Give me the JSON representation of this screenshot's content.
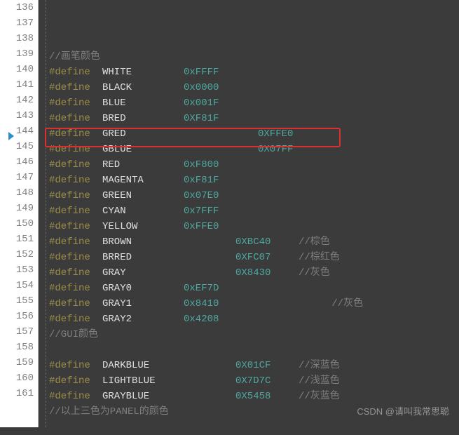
{
  "watermark": "CSDN @请叫我常思聪",
  "lines": [
    {
      "n": 136,
      "cells": []
    },
    {
      "n": 137,
      "cells": [
        {
          "t": "//画笔颜色",
          "cls": "c-comment"
        }
      ]
    },
    {
      "n": 138,
      "cells": [
        {
          "t": "#define ",
          "cls": "c-define seg w1"
        },
        {
          "t": "WHITE",
          "cls": "c-macro seg w2"
        },
        {
          "t": "0xFFFF",
          "cls": "c-hex"
        }
      ]
    },
    {
      "n": 139,
      "cells": [
        {
          "t": "#define ",
          "cls": "c-define seg w1"
        },
        {
          "t": "BLACK",
          "cls": "c-macro seg w2"
        },
        {
          "t": "0x0000",
          "cls": "c-hex"
        }
      ]
    },
    {
      "n": 140,
      "cells": [
        {
          "t": "#define ",
          "cls": "c-define seg w1"
        },
        {
          "t": "BLUE",
          "cls": "c-macro seg w2"
        },
        {
          "t": "0x001F",
          "cls": "c-hex"
        }
      ]
    },
    {
      "n": 141,
      "cells": [
        {
          "t": "#define ",
          "cls": "c-define seg w1"
        },
        {
          "t": "BRED",
          "cls": "c-macro seg w2"
        },
        {
          "t": "0XF81F",
          "cls": "c-hex"
        }
      ]
    },
    {
      "n": 142,
      "cells": [
        {
          "t": "#define ",
          "cls": "c-define seg w1"
        },
        {
          "t": "GRED",
          "cls": "c-macro seg w2"
        },
        {
          "t": "",
          "cls": "seg w4"
        },
        {
          "t": "0XFFE0",
          "cls": "c-hex"
        }
      ]
    },
    {
      "n": 143,
      "cells": [
        {
          "t": "#define ",
          "cls": "c-define seg w1"
        },
        {
          "t": "GBLUE",
          "cls": "c-macro seg w2"
        },
        {
          "t": "",
          "cls": "seg w4"
        },
        {
          "t": "0X07FF",
          "cls": "c-hex"
        }
      ]
    },
    {
      "n": 144,
      "cells": [
        {
          "t": "#define ",
          "cls": "c-define seg w1"
        },
        {
          "t": "RED",
          "cls": "c-macro seg w2"
        },
        {
          "t": "0xF800",
          "cls": "c-hex"
        }
      ]
    },
    {
      "n": 145,
      "cells": [
        {
          "t": "#define ",
          "cls": "c-define seg w1"
        },
        {
          "t": "MAGENTA",
          "cls": "c-macro seg w2"
        },
        {
          "t": "0xF81F",
          "cls": "c-hex"
        }
      ]
    },
    {
      "n": 146,
      "cells": [
        {
          "t": "#define ",
          "cls": "c-define seg w1"
        },
        {
          "t": "GREEN",
          "cls": "c-macro seg w2"
        },
        {
          "t": "0x07E0",
          "cls": "c-hex"
        }
      ]
    },
    {
      "n": 147,
      "cells": [
        {
          "t": "#define ",
          "cls": "c-define seg w1"
        },
        {
          "t": "CYAN",
          "cls": "c-macro seg w2"
        },
        {
          "t": "0x7FFF",
          "cls": "c-hex"
        }
      ]
    },
    {
      "n": 148,
      "cells": [
        {
          "t": "#define ",
          "cls": "c-define seg w1"
        },
        {
          "t": "YELLOW",
          "cls": "c-macro seg w2"
        },
        {
          "t": "0xFFE0",
          "cls": "c-hex"
        }
      ]
    },
    {
      "n": 149,
      "cells": [
        {
          "t": "#define ",
          "cls": "c-define seg w1"
        },
        {
          "t": "BROWN",
          "cls": "c-macro seg w2"
        },
        {
          "t": "",
          "cls": "seg w3"
        },
        {
          "t": "0XBC40",
          "cls": "c-hex seg w5"
        },
        {
          "t": "//棕色",
          "cls": "c-comment"
        }
      ]
    },
    {
      "n": 150,
      "cells": [
        {
          "t": "#define ",
          "cls": "c-define seg w1"
        },
        {
          "t": "BRRED",
          "cls": "c-macro seg w2"
        },
        {
          "t": "",
          "cls": "seg w3"
        },
        {
          "t": "0XFC07",
          "cls": "c-hex seg w5"
        },
        {
          "t": "//棕红色",
          "cls": "c-comment"
        }
      ]
    },
    {
      "n": 151,
      "cells": [
        {
          "t": "#define ",
          "cls": "c-define seg w1"
        },
        {
          "t": "GRAY",
          "cls": "c-macro seg w2"
        },
        {
          "t": "",
          "cls": "seg w3"
        },
        {
          "t": "0X8430",
          "cls": "c-hex seg w5"
        },
        {
          "t": "//灰色",
          "cls": "c-comment"
        }
      ]
    },
    {
      "n": 152,
      "cells": [
        {
          "t": "#define ",
          "cls": "c-define seg w1"
        },
        {
          "t": "GRAY0",
          "cls": "c-macro seg w2"
        },
        {
          "t": "0xEF7D",
          "cls": "c-hex"
        }
      ]
    },
    {
      "n": 153,
      "cells": [
        {
          "t": "#define ",
          "cls": "c-define seg w1"
        },
        {
          "t": "GRAY1",
          "cls": "c-macro seg w2"
        },
        {
          "t": "0x8410      \t\t",
          "cls": "c-hex"
        },
        {
          "t": "//灰色",
          "cls": "c-comment"
        }
      ]
    },
    {
      "n": 154,
      "cells": [
        {
          "t": "#define ",
          "cls": "c-define seg w1"
        },
        {
          "t": "GRAY2",
          "cls": "c-macro seg w2"
        },
        {
          "t": "0x4208",
          "cls": "c-hex"
        }
      ]
    },
    {
      "n": 155,
      "cells": [
        {
          "t": "//GUI颜色",
          "cls": "c-comment"
        }
      ]
    },
    {
      "n": 156,
      "cells": []
    },
    {
      "n": 157,
      "cells": [
        {
          "t": "#define ",
          "cls": "c-define seg w1"
        },
        {
          "t": "DARKBLUE",
          "cls": "c-macro seg w2"
        },
        {
          "t": "",
          "cls": "seg w3"
        },
        {
          "t": "0X01CF",
          "cls": "c-hex seg w5"
        },
        {
          "t": "//深蓝色",
          "cls": "c-comment"
        }
      ]
    },
    {
      "n": 158,
      "cells": [
        {
          "t": "#define ",
          "cls": "c-define seg w1"
        },
        {
          "t": "LIGHTBLUE",
          "cls": "c-macro seg w2"
        },
        {
          "t": "",
          "cls": "seg w3"
        },
        {
          "t": "0X7D7C",
          "cls": "c-hex seg w5"
        },
        {
          "t": "//浅蓝色",
          "cls": "c-comment"
        }
      ]
    },
    {
      "n": 159,
      "cells": [
        {
          "t": "#define ",
          "cls": "c-define seg w1"
        },
        {
          "t": "GRAYBLUE",
          "cls": "c-macro seg w2"
        },
        {
          "t": "",
          "cls": "seg w3"
        },
        {
          "t": "0X5458",
          "cls": "c-hex seg w5"
        },
        {
          "t": "//灰蓝色",
          "cls": "c-comment"
        }
      ]
    },
    {
      "n": 160,
      "cells": [
        {
          "t": "//以上三色为PANEL的颜色",
          "cls": "c-comment"
        }
      ]
    },
    {
      "n": 161,
      "cells": []
    }
  ]
}
